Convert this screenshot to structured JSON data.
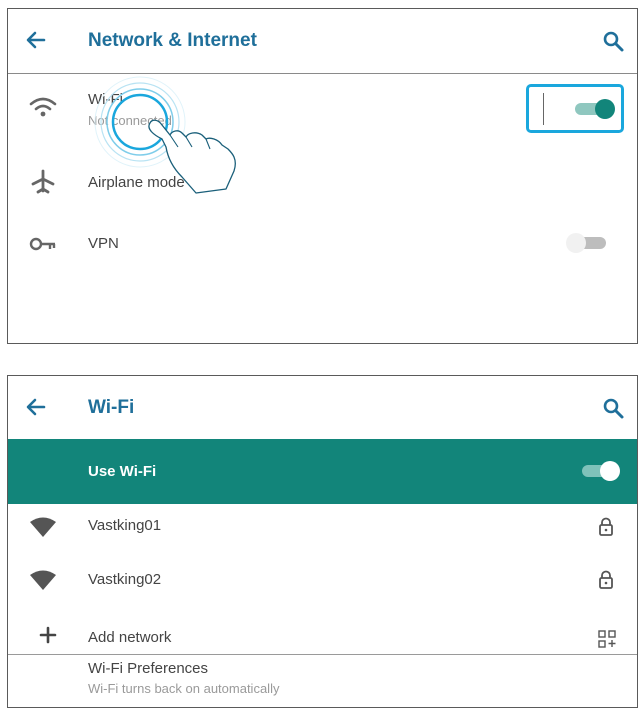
{
  "network_screen": {
    "title": "Network & Internet",
    "items": [
      {
        "label": "Wi-Fi",
        "sublabel": "Not connected",
        "icon": "wifi-icon",
        "toggle_on": true
      },
      {
        "label": "Airplane mode",
        "icon": "airplane-icon"
      },
      {
        "label": "VPN",
        "icon": "vpn-key-icon",
        "toggle_on": false
      }
    ]
  },
  "wifi_screen": {
    "title": "Wi-Fi",
    "use_wifi": {
      "label": "Use Wi-Fi",
      "toggle_on": true
    },
    "networks": [
      {
        "name": "Vastking01",
        "icon": "wifi-signal-icon",
        "locked": true
      },
      {
        "name": "Vastking02",
        "icon": "wifi-signal-icon",
        "locked": true
      }
    ],
    "add_network": {
      "label": "Add network",
      "icon": "plus-icon",
      "trailing_icon": "qr-code-icon"
    },
    "preferences": {
      "label": "Wi-Fi Preferences",
      "sublabel": "Wi-Fi turns back on automatically"
    }
  },
  "colors": {
    "title_blue": "#1f6f9a",
    "accent_teal": "#12857a",
    "highlight_blue": "#1aa7dd",
    "icon_grey": "#666666"
  }
}
